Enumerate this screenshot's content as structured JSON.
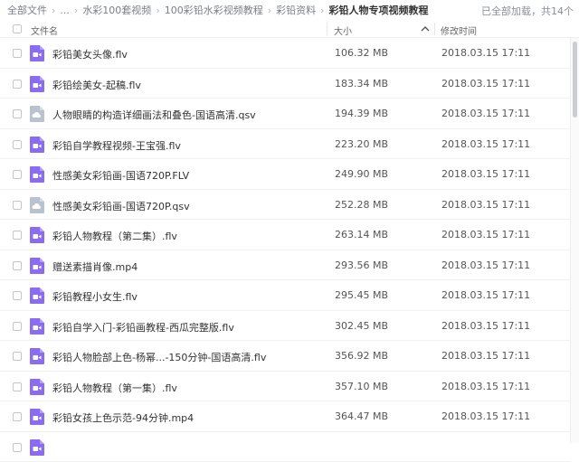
{
  "breadcrumb": {
    "items": [
      "全部文件",
      "...",
      "水彩100套视频",
      "100彩铅水彩视频教程",
      "彩铅资料",
      "彩铅人物专项视频教程"
    ]
  },
  "status": "已全部加载，共14个",
  "table": {
    "headers": {
      "name": "文件名",
      "size": "大小",
      "modified": "修改时间"
    },
    "sort": {
      "column": "size",
      "direction": "ascending"
    },
    "rows": [
      {
        "name": "彩铅美女头像.flv",
        "size": "106.32 MB",
        "modified": "2018.03.15 17:11",
        "icon": "video-file-icon"
      },
      {
        "name": "彩铅绘美女-起稿.flv",
        "size": "183.34 MB",
        "modified": "2018.03.15 17:11",
        "icon": "video-file-icon"
      },
      {
        "name": "人物眼睛的构造详细画法和叠色-国语高清.qsv",
        "size": "194.39 MB",
        "modified": "2018.03.15 17:11",
        "icon": "cloud-file-icon"
      },
      {
        "name": "彩铅自学教程视频-王宝强.flv",
        "size": "223.20 MB",
        "modified": "2018.03.15 17:11",
        "icon": "video-file-icon"
      },
      {
        "name": "性感美女彩铅画-国语720P.FLV",
        "size": "249.90 MB",
        "modified": "2018.03.15 17:11",
        "icon": "video-file-icon"
      },
      {
        "name": "性感美女彩铅画-国语720P.qsv",
        "size": "252.28 MB",
        "modified": "2018.03.15 17:11",
        "icon": "cloud-file-icon"
      },
      {
        "name": "彩铅人物教程（第二集）.flv",
        "size": "263.14 MB",
        "modified": "2018.03.15 17:11",
        "icon": "video-file-icon"
      },
      {
        "name": "赠送素描肖像.mp4",
        "size": "293.56 MB",
        "modified": "2018.03.15 17:11",
        "icon": "video-file-icon"
      },
      {
        "name": "彩铅教程小女生.flv",
        "size": "295.45 MB",
        "modified": "2018.03.15 17:11",
        "icon": "video-file-icon"
      },
      {
        "name": "彩铅自学入门-彩铅画教程-西瓜完整版.flv",
        "size": "302.45 MB",
        "modified": "2018.03.15 17:11",
        "icon": "video-file-icon"
      },
      {
        "name": "彩铅人物脸部上色-杨幂...-150分钟-国语高清.flv",
        "size": "356.92 MB",
        "modified": "2018.03.15 17:11",
        "icon": "video-file-icon"
      },
      {
        "name": "彩铅人物教程（第一集）.flv",
        "size": "357.10 MB",
        "modified": "2018.03.15 17:11",
        "icon": "video-file-icon"
      },
      {
        "name": "彩铅女孩上色示范-94分钟.mp4",
        "size": "364.47 MB",
        "modified": "2018.03.15 17:11",
        "icon": "video-file-icon"
      },
      {
        "name": "",
        "size": "",
        "modified": "",
        "icon": "video-file-icon"
      }
    ]
  },
  "colors": {
    "video_icon": "#8b6cf0",
    "cloud_icon": "#b9c3cf",
    "breadcrumb_link": "#7a7f87",
    "text": "#333333"
  }
}
